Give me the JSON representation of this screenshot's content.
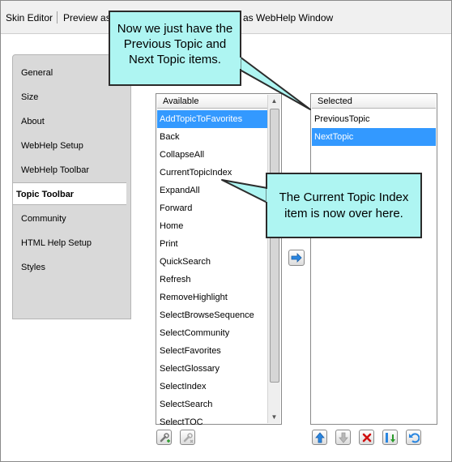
{
  "window": {
    "tabs": [
      "Skin Editor",
      "Preview as",
      "as WebHelp Window"
    ]
  },
  "nav": {
    "items": [
      {
        "label": "General"
      },
      {
        "label": "Size"
      },
      {
        "label": "About"
      },
      {
        "label": "WebHelp Setup"
      },
      {
        "label": "WebHelp Toolbar"
      },
      {
        "label": "Topic Toolbar"
      },
      {
        "label": "Community"
      },
      {
        "label": "HTML Help Setup"
      },
      {
        "label": "Styles"
      }
    ],
    "selected": "Topic Toolbar"
  },
  "available": {
    "header": "Available",
    "items": [
      "AddTopicToFavorites",
      "Back",
      "CollapseAll",
      "CurrentTopicIndex",
      "ExpandAll",
      "Forward",
      "Home",
      "Print",
      "QuickSearch",
      "Refresh",
      "RemoveHighlight",
      "SelectBrowseSequence",
      "SelectCommunity",
      "SelectFavorites",
      "SelectGlossary",
      "SelectIndex",
      "SelectSearch",
      "SelectTOC"
    ],
    "selected": "AddTopicToFavorites"
  },
  "selected": {
    "header": "Selected",
    "items": [
      "PreviousTopic",
      "NextTopic"
    ],
    "selected": "NextTopic"
  },
  "callouts": {
    "top": "Now we just have the Previous Topic and Next Topic items.",
    "middle": "The Current Topic Index item is now over here."
  },
  "colors": {
    "selection": "#3399ff",
    "callout_fill": "#aef5f2",
    "nav_panel": "#d9d9d9"
  }
}
